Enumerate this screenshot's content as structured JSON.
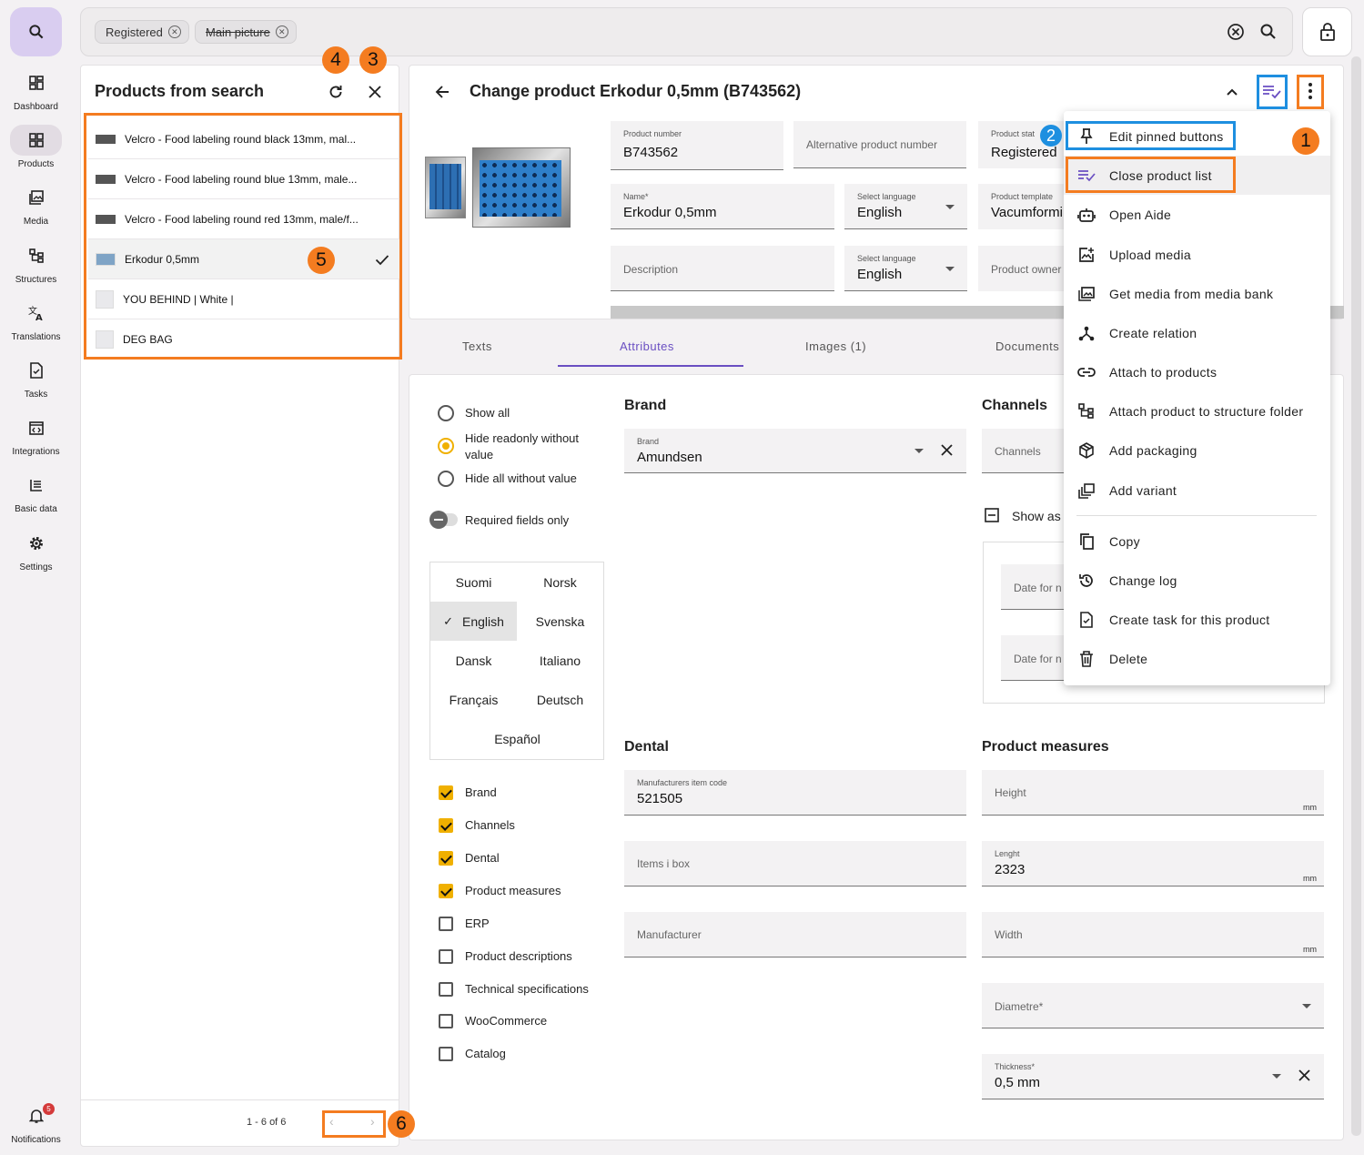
{
  "nav": {
    "items": [
      {
        "label": "Dashboard",
        "icon": "dashboard-icon"
      },
      {
        "label": "Products",
        "icon": "products-icon"
      },
      {
        "label": "Media",
        "icon": "media-icon"
      },
      {
        "label": "Structures",
        "icon": "structures-icon"
      },
      {
        "label": "Translations",
        "icon": "translate-icon"
      },
      {
        "label": "Tasks",
        "icon": "tasks-icon"
      },
      {
        "label": "Integrations",
        "icon": "integrations-icon"
      },
      {
        "label": "Basic data",
        "icon": "basic-data-icon"
      },
      {
        "label": "Settings",
        "icon": "gear-icon"
      }
    ],
    "notifications": {
      "label": "Notifications",
      "count": "5"
    }
  },
  "search": {
    "chips": [
      {
        "label": "Registered",
        "strike": false
      },
      {
        "label": "Main picture",
        "strike": true
      }
    ]
  },
  "product_list": {
    "title": "Products from search",
    "items": [
      {
        "name": "Velcro - Food labeling round black 13mm, mal...",
        "selected": false
      },
      {
        "name": "Velcro - Food labeling round blue 13mm, male...",
        "selected": false
      },
      {
        "name": "Velcro - Food labeling round red 13mm, male/f...",
        "selected": false
      },
      {
        "name": "Erkodur 0,5mm",
        "selected": true
      },
      {
        "name": "YOU BEHIND | White |",
        "selected": false
      },
      {
        "name": "DEG BAG",
        "selected": false
      }
    ],
    "pagination": "1 - 6 of 6"
  },
  "annotations": [
    "1",
    "2",
    "3",
    "4",
    "5",
    "6"
  ],
  "header": {
    "title": "Change product Erkodur 0,5mm (B743562)",
    "fields": {
      "product_number": {
        "label": "Product number",
        "value": "B743562"
      },
      "alt_number": {
        "placeholder": "Alternative product number"
      },
      "status": {
        "label": "Product stat",
        "value": "Registered"
      },
      "name": {
        "label": "Name*",
        "value": "Erkodur 0,5mm"
      },
      "name_lang": {
        "label": "Select language",
        "value": "English"
      },
      "template": {
        "label": "Product template",
        "value": "Vacumformi"
      },
      "description": {
        "placeholder": "Description"
      },
      "desc_lang": {
        "label": "Select language",
        "value": "English"
      },
      "owner": {
        "placeholder": "Product owner"
      }
    }
  },
  "tabs": [
    {
      "label": "Texts",
      "active": false
    },
    {
      "label": "Attributes",
      "active": true
    },
    {
      "label": "Images (1)",
      "active": false
    },
    {
      "label": "Documents",
      "active": false
    }
  ],
  "filters": {
    "radios": [
      {
        "label": "Show all",
        "checked": false
      },
      {
        "label": "Hide readonly without value",
        "checked": true
      },
      {
        "label": "Hide all without value",
        "checked": false
      }
    ],
    "toggle_label": "Required fields only",
    "languages": [
      "Suomi",
      "Norsk",
      "English",
      "Svenska",
      "Dansk",
      "Italiano",
      "Français",
      "Deutsch",
      "Español"
    ],
    "selected_language": "English",
    "groups": [
      {
        "label": "Brand",
        "checked": true
      },
      {
        "label": "Channels",
        "checked": true
      },
      {
        "label": "Dental",
        "checked": true
      },
      {
        "label": "Product measures",
        "checked": true
      },
      {
        "label": "ERP",
        "checked": false
      },
      {
        "label": "Product descriptions",
        "checked": false
      },
      {
        "label": "Technical specifications",
        "checked": false
      },
      {
        "label": "WooCommerce",
        "checked": false
      },
      {
        "label": "Catalog",
        "checked": false
      }
    ]
  },
  "brand": {
    "title": "Brand",
    "label": "Brand",
    "value": "Amundsen"
  },
  "channels": {
    "title": "Channels",
    "placeholder": "Channels",
    "show_as": "Show as",
    "date1": "Date for n",
    "date2": "Date for n"
  },
  "dental": {
    "title": "Dental",
    "manufacturers_item_code": {
      "label": "Manufacturers item code",
      "value": "521505"
    },
    "items_in_box": {
      "placeholder": "Items i box"
    },
    "manufacturer": {
      "placeholder": "Manufacturer"
    }
  },
  "measures": {
    "title": "Product measures",
    "height": {
      "placeholder": "Height",
      "unit": "mm"
    },
    "length": {
      "label": "Lenght",
      "value": "2323",
      "unit": "mm"
    },
    "width": {
      "placeholder": "Width",
      "unit": "mm"
    },
    "diameter": {
      "placeholder": "Diametre*"
    },
    "thickness": {
      "label": "Thickness*",
      "value": "0,5 mm"
    }
  },
  "menu": {
    "items": [
      {
        "label": "Edit pinned buttons",
        "icon": "pin-icon"
      },
      {
        "label": "Close product list",
        "icon": "playlist-check-icon"
      },
      {
        "label": "Open Aide",
        "icon": "robot-icon"
      },
      {
        "label": "Upload media",
        "icon": "upload-media-icon"
      },
      {
        "label": "Get media from media bank",
        "icon": "media-bank-icon"
      },
      {
        "label": "Create relation",
        "icon": "relation-icon"
      },
      {
        "label": "Attach to products",
        "icon": "link-icon"
      },
      {
        "label": "Attach product to structure folder",
        "icon": "structure-icon"
      },
      {
        "label": "Add packaging",
        "icon": "package-icon"
      },
      {
        "label": "Add variant",
        "icon": "variant-icon"
      },
      {
        "label": "Copy",
        "icon": "copy-icon"
      },
      {
        "label": "Change log",
        "icon": "history-icon"
      },
      {
        "label": "Create task for this product",
        "icon": "task-icon"
      },
      {
        "label": "Delete",
        "icon": "trash-icon"
      }
    ]
  },
  "colors": {
    "accent": "#6a4fc2",
    "annotation_orange": "#f47c20",
    "annotation_blue": "#1e8fe0",
    "checkbox": "#f0b000"
  }
}
